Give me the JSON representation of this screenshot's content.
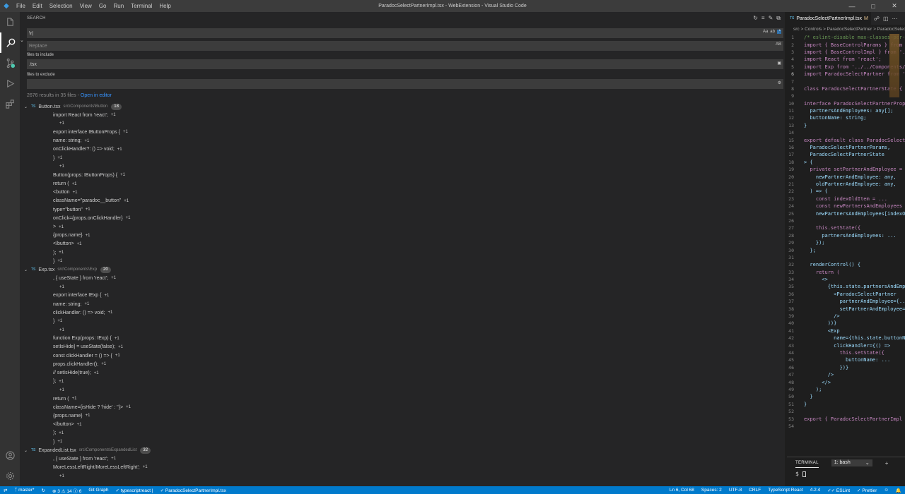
{
  "window": {
    "title": "ParadocSelectPartnerImpl.tsx - WebExtension - Visual Studio Code",
    "menu": [
      "File",
      "Edit",
      "Selection",
      "View",
      "Go",
      "Run",
      "Terminal",
      "Help"
    ]
  },
  "activity": [
    "files-icon",
    "search-icon",
    "source-control-icon",
    "run-debug-icon",
    "extensions-icon"
  ],
  "search": {
    "header": "SEARCH",
    "query": "\\r|",
    "replace_placeholder": "Replace",
    "include_label": "files to include",
    "include_value": ".tsx",
    "exclude_label": "files to exclude",
    "exclude_value": "",
    "match_case": "Aa",
    "whole_word": "ab",
    "preserve_case": "AB",
    "results_summary": "2676 results in 35 files - ",
    "open_in_editor": "Open in editor"
  },
  "results": [
    {
      "file": "Button.tsx",
      "path": "src\\Components\\Button",
      "count": "18",
      "matches": [
        "import React from 'react';",
        "",
        "export interface IButtonProps {",
        "name: string;",
        "onClickHandler?: () => void;",
        "}",
        "",
        "Button(props: IButtonProps) {",
        "return (",
        "<button",
        "className=\"paradoc__button\"",
        "type=\"button\"",
        "onClick={props.onClickHandler}",
        ">",
        "{props.name}",
        "</button>",
        ");",
        "}"
      ]
    },
    {
      "file": "Exp.tsx",
      "path": "src\\Components\\Exp",
      "count": "20",
      "matches": [
        ", { useState } from 'react';",
        "",
        "export interface IExp {",
        "name: string;",
        "clickHandler: () => void;",
        "}",
        "",
        "function Exp(props: IExp) {",
        "setIsHide] = useState(false);",
        "const clickHandler = () => {",
        "props.clickHandler();",
        "// setIsHide(true);",
        "};",
        "",
        "return (",
        "className={isHide ? 'hide' : ''}>",
        "{props.name}",
        "</button>",
        ");",
        "}"
      ]
    },
    {
      "file": "ExpandedList.tsx",
      "path": "src\\Components\\ExpandedList",
      "count": "32",
      "matches": [
        ", { useState } from 'react';",
        "MoreLessLeftRight/MoreLessLeftRight';",
        ""
      ]
    }
  ],
  "match_suffix": "+1",
  "editor": {
    "tab": "ParadocSelectPartnerImpl.tsx",
    "tab_mod": "M",
    "breadcrumb": "src > Controls > ParadocSelectPartner > ParadocSelectPartnerImpl.tsx",
    "current_line": "6",
    "lines": [
      "/* eslint-disable max-classes-per-file */",
      "import { BaseControlParams } from '...';",
      "import { BaseControlImpl } from '...';",
      "import React from 'react';",
      "import Exp from '../../Components/Exp';",
      "import ParadocSelectPartner from '...';",
      "",
      "class ParadocSelectPartnerState {",
      "",
      "interface ParadocSelectPartnerProps {",
      "  partnersAndEmployees: any[];",
      "  buttonName: string;",
      "}",
      "",
      "export default class ParadocSelectPartnerImpl extends",
      "  ParadocSelectPartnerParams,",
      "  ParadocSelectPartnerState",
      "> {",
      "  private setPartnerAndEmployee = (",
      "    newPartnerAndEmployee: any,",
      "    oldPartnerAndEmployee: any,",
      "  ) => {",
      "    const indexOldItem = ...",
      "    const newPartnersAndEmployees = ...",
      "    newPartnersAndEmployees[indexOldItem] = ...",
      "",
      "    this.setState({",
      "      partnersAndEmployees: ...",
      "    });",
      "  };",
      "",
      "  renderControl() {",
      "    return (",
      "      <>",
      "        {this.state.partnersAndEmployees.map(",
      "          <ParadocSelectPartner",
      "            partnerAndEmployee={...}",
      "            setPartnerAndEmployee={...}",
      "          />",
      "        ))}",
      "        <Exp",
      "          name={this.state.buttonName}",
      "          clickHandler={() =>",
      "            this.setState({",
      "              buttonName: ...",
      "            })}",
      "        />",
      "      </>",
      "    );",
      "  }",
      "}",
      "",
      "export { ParadocSelectPartnerImpl };",
      ""
    ]
  },
  "terminal": {
    "tab": "TERMINAL",
    "shell": "1: bash",
    "prompt": "$ "
  },
  "status": {
    "branch": "master*",
    "errors": "3",
    "warnings": "14",
    "info": "6",
    "git_graph": "Git Graph",
    "lang_check": "typescriptreact",
    "file_check": "ParadocSelectPartnerImpl.tsx",
    "position": "Ln 6, Col 68",
    "spaces": "Spaces: 2",
    "encoding": "UTF-8",
    "eol": "CRLF",
    "language": "TypeScript React",
    "ts_version": "4.2.4",
    "eslint": "ESLint",
    "prettier": "Prettier"
  },
  "colors": {
    "statusbar": "#007acc",
    "accent": "#3794ff"
  }
}
